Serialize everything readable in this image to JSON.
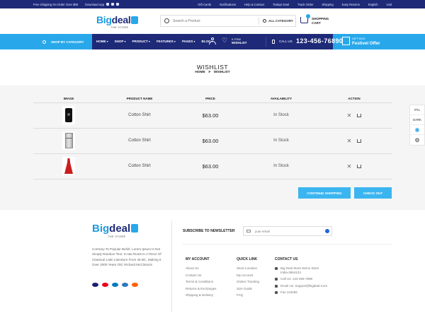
{
  "topbar": {
    "promo": "Free Shipping On Order Over $99",
    "download": "Download App",
    "links": [
      "Gift Cards",
      "Notifications",
      "Help & Contact",
      "Todays Deal",
      "Track Order",
      "Shipping",
      "Easy Returns",
      "English",
      "Usd"
    ]
  },
  "header": {
    "logo_big": "Big",
    "logo_deal": "deal",
    "logo_sub": "THE STORE",
    "search_placeholder": "Search a Product",
    "category_label": "ALL CATEGORY",
    "cart_label_1": "SHOPPING",
    "cart_label_2": "CART"
  },
  "nav": {
    "category_button": "SHOP BY CATEGORY",
    "menu": [
      "HOME",
      "SHOP",
      "PRODUCT",
      "FEATURES",
      "PAGES",
      "BLOG"
    ],
    "wish_count": "0 ITEM",
    "wish_label": "WISHLIST",
    "call_label": "CALL US",
    "phone": "123-456-76890",
    "gift_small": "GIFT BOX",
    "gift_big": "Festivel Offer"
  },
  "page": {
    "title": "WISHLIST",
    "breadcrumb_home": "HOME",
    "breadcrumb_current": "WISHLIST"
  },
  "wishlist": {
    "headers": [
      "IMAGE",
      "PRODUCT NAME",
      "PRICE",
      "AVAILABILITY",
      "ACTION"
    ],
    "rows": [
      {
        "image": "phone-image",
        "name": "Cotton Shirt",
        "price": "$63.00",
        "availability": "In Stock"
      },
      {
        "image": "fridge-image",
        "name": "Cotton Shirt",
        "price": "$63.00",
        "availability": "In Stock"
      },
      {
        "image": "dress-image",
        "name": "Cotton Shirt",
        "price": "$63.00",
        "availability": "In Stock"
      }
    ],
    "continue_label": "CONTINUE SHOPPING",
    "checkout_label": "CHECK OUT"
  },
  "side_widget": {
    "rtl": "RTL",
    "dark": "DARK"
  },
  "footer": {
    "about": "Contrary To Popular Belief, Lorem Ipsum Is Not Simply Random Text. It Has Roots In A Piece Of Classical Latin Literature From 45 BC, Making It Over 2000 Years Old. Richard McClintock.",
    "newsletter_title": "SUBSCRIBE TO NEWSLETTER",
    "email_placeholder": "your email",
    "account_title": "MY ACCOUNT",
    "account_links": [
      "About Us",
      "Contact Us",
      "Terms & Conditions",
      "Returns & Exchanges",
      "Shipping & Delivery"
    ],
    "quick_title": "QUICK LINK",
    "quick_links": [
      "Store Location",
      "My Account",
      "Orders Tracking",
      "Size Guide",
      "FAQ"
    ],
    "contact_title": "CONTACT US",
    "contact_items": [
      "Big Deal Store Demo Store India-3654123",
      "Call Us: 123-456-7898",
      "Email Us: Support@bigdeal.Com",
      "Fax 123456"
    ],
    "payment_colors": [
      "#1a1f71",
      "#eb001b",
      "#0079be",
      "#2e77bb",
      "#ff5f00"
    ]
  },
  "colors": {
    "navy": "#1e2a78",
    "accent": "#28a8ea",
    "button": "#3bb5f0"
  }
}
